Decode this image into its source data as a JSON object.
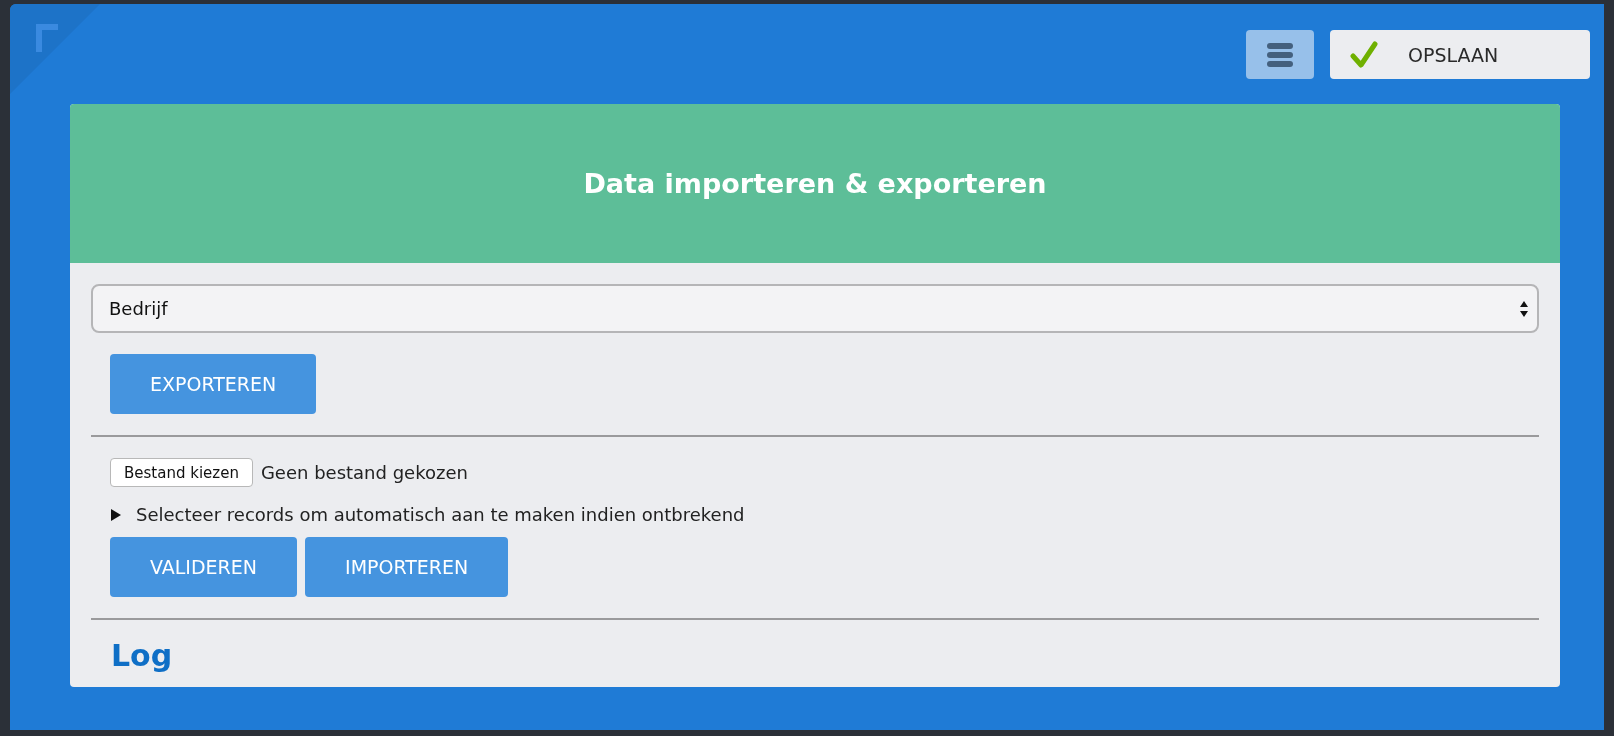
{
  "toolbar": {
    "save_button": "OPSLAAN"
  },
  "panel": {
    "title": "Data importeren & exporteren",
    "entity_select": {
      "value": "Bedrijf"
    },
    "export_button": "EXPORTEREN",
    "file_input": {
      "button": "Bestand kiezen",
      "status": "Geen bestand gekozen"
    },
    "details": {
      "summary": "Selecteer records om automatisch aan te maken indien ontbrekend",
      "expanded": false
    },
    "import_buttons": [
      "VALIDEREN",
      "IMPORTEREN"
    ],
    "log_heading": "Log"
  }
}
